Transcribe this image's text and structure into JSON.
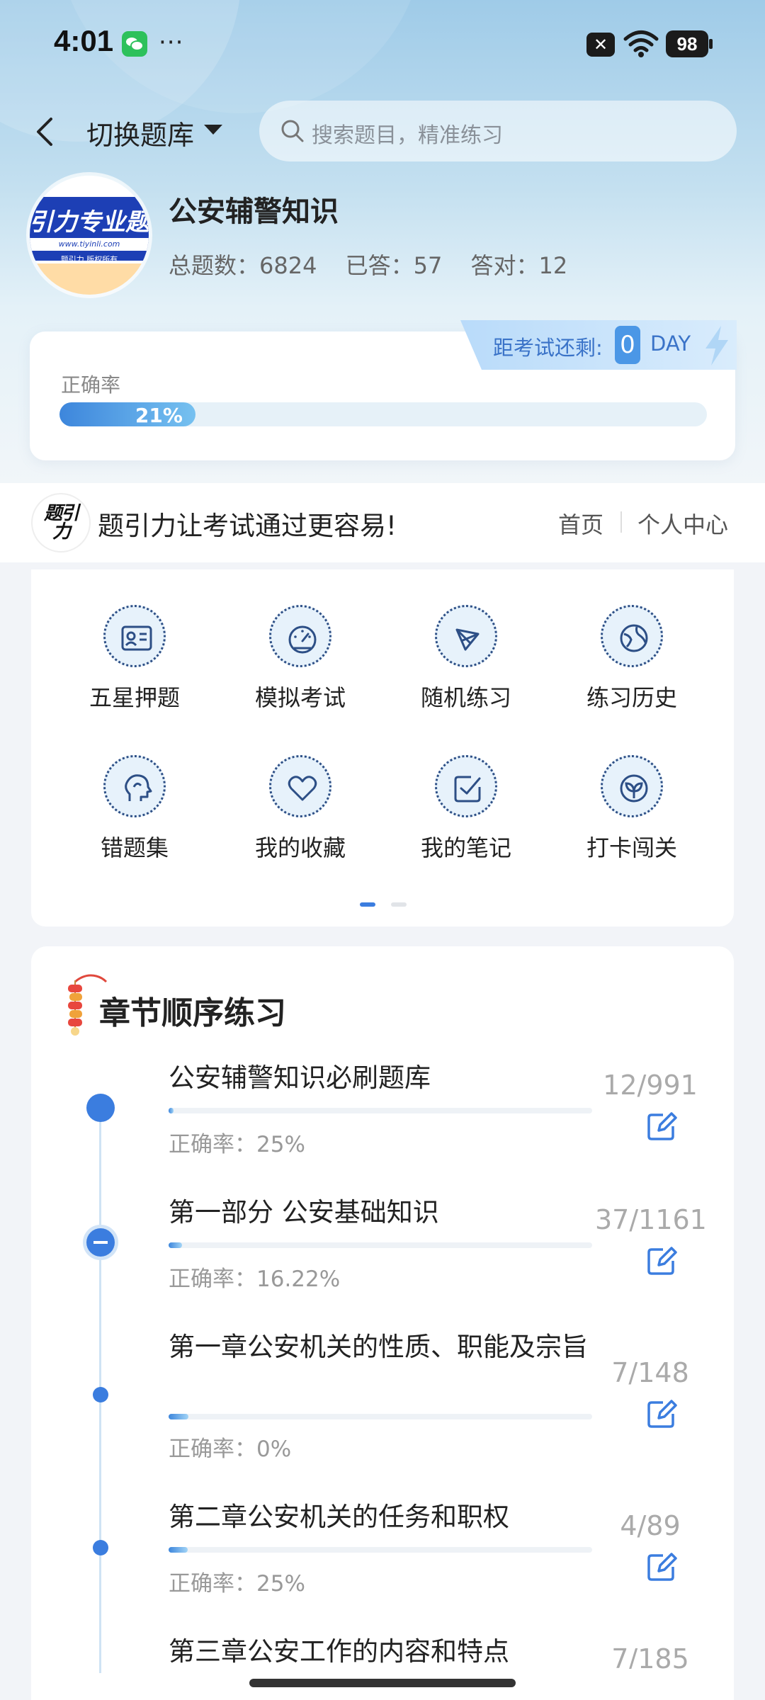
{
  "status_bar": {
    "time": "4:01",
    "more": "···",
    "battery": "98"
  },
  "header": {
    "switch_label": "切换题库",
    "search_placeholder": "搜索题目，精准练习"
  },
  "bank": {
    "logo_text": "引力专业题",
    "logo_url": "www.tiyinli.com",
    "logo_small": "题引力 版权所有",
    "title": "公安辅警知识",
    "total_label": "总题数：",
    "total": "6824",
    "answered_label": "已答：",
    "answered": "57",
    "correct_label": "答对：",
    "correct": "12"
  },
  "exam": {
    "countdown_label": "距考试还剩:",
    "days": "0",
    "unit": "DAY"
  },
  "accuracy": {
    "label": "正确率",
    "value_text": "21%",
    "value": 0.21
  },
  "banner": {
    "logo_text": "题引力",
    "slogan": "题引力让考试通过更容易!",
    "nav_home": "首页",
    "nav_profile": "个人中心"
  },
  "grid": [
    {
      "label": "五星押题",
      "icon": "id-card-icon"
    },
    {
      "label": "模拟考试",
      "icon": "speedometer-icon"
    },
    {
      "label": "随机练习",
      "icon": "shuffle-icon"
    },
    {
      "label": "练习历史",
      "icon": "globe-icon"
    },
    {
      "label": "错题集",
      "icon": "head-icon"
    },
    {
      "label": "我的收藏",
      "icon": "heart-icon"
    },
    {
      "label": "我的笔记",
      "icon": "note-check-icon"
    },
    {
      "label": "打卡闯关",
      "icon": "sprout-icon"
    }
  ],
  "pager": {
    "pages": 2,
    "active": 1
  },
  "chapters": {
    "title": "章节顺序练习",
    "items": [
      {
        "name": "公安辅警知识必刷题库",
        "accuracy": "正确率：25%",
        "count": "12/991",
        "progress": 0.012
      },
      {
        "name": "第一部分 公安基础知识",
        "accuracy": "正确率：16.22%",
        "count": "37/1161",
        "progress": 0.032
      },
      {
        "name": "第一章公安机关的性质、职能及宗旨",
        "accuracy": "正确率：0%",
        "count": "7/148",
        "progress": 0.047
      },
      {
        "name": "第二章公安机关的任务和职权",
        "accuracy": "正确率：25%",
        "count": "4/89",
        "progress": 0.045
      },
      {
        "name": "第三章公安工作的内容和特点",
        "accuracy": "",
        "count": "7/185",
        "progress": 0.038
      }
    ]
  },
  "colors": {
    "accent": "#3b7ddf",
    "icon_stroke": "#2d4f86",
    "wechat": "#2dc15b"
  }
}
